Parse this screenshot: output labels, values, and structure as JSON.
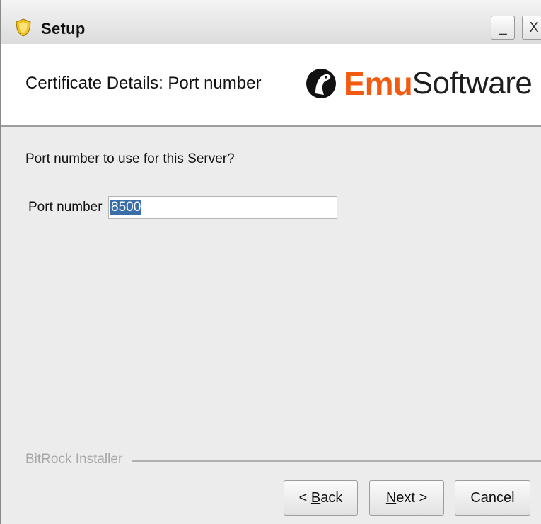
{
  "window": {
    "title": "Setup",
    "icon": "setup-shield-icon",
    "minimize_symbol": "_",
    "close_symbol": "X"
  },
  "header": {
    "title": "Certificate Details: Port number",
    "logo": {
      "brand_bold": "Emu",
      "brand_regular": "Software",
      "brand_color": "#f25a0f"
    }
  },
  "content": {
    "question": "Port number to use for this Server?",
    "port_label": "Port number",
    "port_value": "8500"
  },
  "footer": {
    "installer_label": "BitRock Installer",
    "back": {
      "prefix": "< ",
      "mnemonic": "B",
      "rest": "ack"
    },
    "next": {
      "mnemonic": "N",
      "rest": "ext >"
    },
    "cancel": "Cancel"
  },
  "colors": {
    "selection": "#3a6ea8",
    "background": "#ececec"
  }
}
